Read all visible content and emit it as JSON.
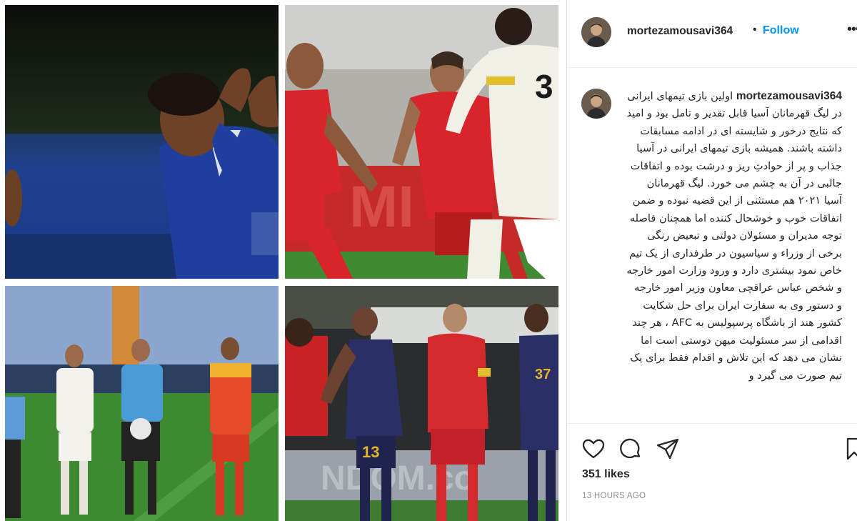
{
  "post": {
    "images": [
      {
        "icon": "photo-player-celebrating-blue-kit"
      },
      {
        "icon": "photo-red-and-white-players-match"
      },
      {
        "icon": "photo-captains-with-referee"
      },
      {
        "icon": "photo-red-and-navy-players-match"
      }
    ]
  },
  "header": {
    "username": "mortezamousavi364",
    "separator": "•",
    "follow_label": "Follow",
    "more_icon": "more-options-icon"
  },
  "caption": {
    "username": "mortezamousavi364",
    "text": "اولین بازی تیمهای ایرانی در لیگ قهرمانان آسیا قابل تقدیر و تامل بود و امید که نتایج درخور و شایسته ای در ادامه مسابقات داشته باشند. همیشه بازی تیمهای ایرانی در آسیا جذاب و پر از حوادثِ ریز و درشت بوده و اتفاقات جالبی در آن به چشم می خورد. لیگ قهرمانان آسیا ۲۰۲۱ هم مستثنی از این قضیه نبوده و ضمن اتفاقات خوب و خوشحال کننده اما همچنان فاصله توجه مدیران و مسئولان دولتی و تبعیض رنگی برخی از وزراء و سیاسیون در طرفداری از یک تیم خاص نمود بیشتری دارد و ورود وزارت امور خارجه و شخص عباس عراقچی معاون وزیر امور خارجه و دستور وی به سفارت ایران برای حل شکایت کشور هند از باشگاه پرسپولیس به AFC ، هر چند اقدامی از سر مسئولیت میهن دوستی است اما نشان می دهد که این تلاش و اقدام فقط برای یک تیم صورت می گیرد و"
  },
  "actions": {
    "like_icon": "heart-icon",
    "comment_icon": "comment-icon",
    "share_icon": "share-icon",
    "save_icon": "bookmark-icon",
    "likes": "351 likes",
    "timestamp": "13 HOURS AGO"
  },
  "colors": {
    "follow": "#0095f6",
    "text": "#262626",
    "muted": "#8e8e8e",
    "border": "#dbdbdb"
  }
}
